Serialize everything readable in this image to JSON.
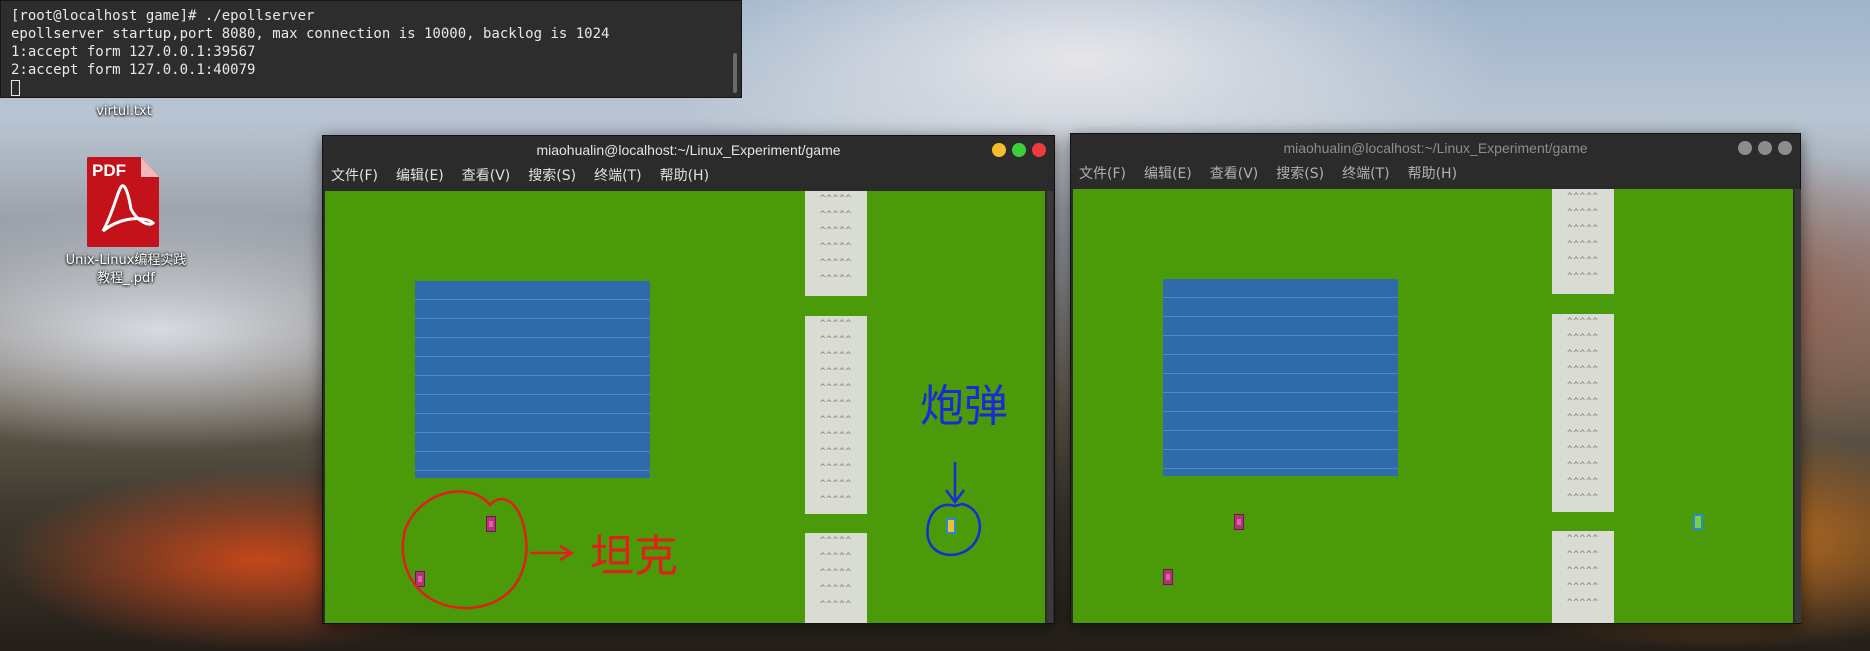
{
  "terminal": {
    "lines": [
      "[root@localhost game]# ./epollserver",
      "epollserver startup,port 8080, max connection is 10000, backlog is 1024",
      "1:accept form 127.0.0.1:39567",
      "2:accept form 127.0.0.1:40079"
    ]
  },
  "desktop": {
    "file1": "virtul.txt",
    "file2_line1": "Unix-Linux编程实践",
    "file2_line2": "教程_.pdf",
    "pdf_badge": "PDF"
  },
  "window_left": {
    "title": "miaohualin@localhost:~/Linux_Experiment/game",
    "menu": [
      "文件(F)",
      "编辑(E)",
      "查看(V)",
      "搜索(S)",
      "终端(T)",
      "帮助(H)"
    ]
  },
  "window_right": {
    "title": "miaohualin@localhost:~/Linux_Experiment/game",
    "menu": [
      "文件(F)",
      "编辑(E)",
      "查看(V)",
      "搜索(S)",
      "终端(T)",
      "帮助(H)"
    ]
  },
  "annotations": {
    "tank_label": "坦克",
    "bullet_label": "炮弹"
  },
  "wall_glyphs": "^^^^^",
  "colors": {
    "grass": "#4a9a0a",
    "water": "#2f6aaa",
    "wall": "#d9dcd2",
    "tank": "#b0357a",
    "annotation_red": "#e0201a",
    "annotation_blue": "#1a2ad8",
    "btn_yellow": "#f5bd2d",
    "btn_green": "#3dcf3a",
    "btn_red": "#ee3b3b"
  }
}
